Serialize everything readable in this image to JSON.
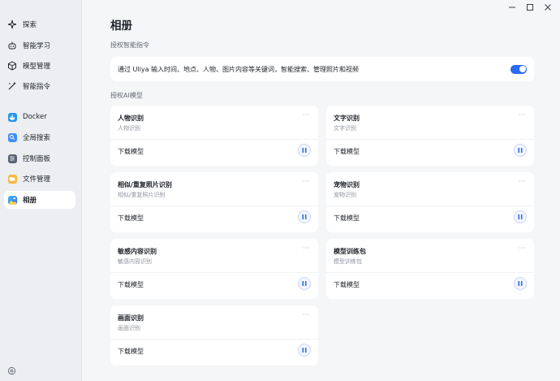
{
  "sidebar": {
    "items": [
      {
        "label": "探索",
        "icon": "sparkle-icon"
      },
      {
        "label": "智能学习",
        "icon": "robot-icon"
      },
      {
        "label": "模型管理",
        "icon": "cube-icon"
      },
      {
        "label": "智能指令",
        "icon": "wand-icon"
      },
      {
        "label": "Docker",
        "icon": "docker-icon"
      },
      {
        "label": "全局搜索",
        "icon": "search-app-icon"
      },
      {
        "label": "控制面板",
        "icon": "control-panel-icon"
      },
      {
        "label": "文件管理",
        "icon": "folder-icon"
      },
      {
        "label": "相册",
        "icon": "photo-album-icon",
        "active": true
      }
    ]
  },
  "header": {
    "title": "相册"
  },
  "auth_section": {
    "title": "授权智能指令",
    "text": "通过 Uliya 输入时间、地点、人物、图片内容等关键词，智能搜索、管理照片和视频",
    "toggle_on": true
  },
  "models_section": {
    "title": "授权AI模型",
    "download_label": "下载模型",
    "more_label": "···",
    "cards": [
      {
        "name": "人物识别",
        "subtitle": "人物识别"
      },
      {
        "name": "文字识别",
        "subtitle": "文字识别"
      },
      {
        "name": "相似/重复照片识别",
        "subtitle": "相似/重复照片识别"
      },
      {
        "name": "宠物识别",
        "subtitle": "宠物识别"
      },
      {
        "name": "敏感内容识别",
        "subtitle": "敏感内容识别"
      },
      {
        "name": "模型训练包",
        "subtitle": "模型训练包"
      },
      {
        "name": "画面识别",
        "subtitle": "画面识别"
      }
    ]
  },
  "colors": {
    "accent": "#2a6bf0",
    "sidebar_bg": "#eceef2",
    "page_bg": "#f5f6f8"
  }
}
